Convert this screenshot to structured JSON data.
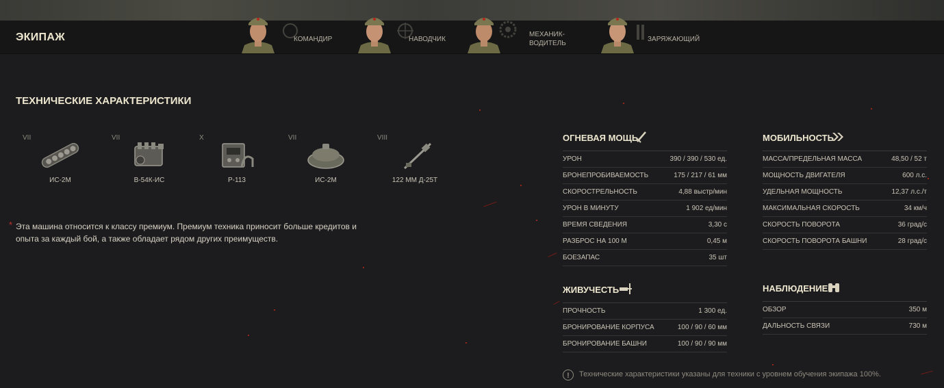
{
  "crew": {
    "title": "ЭКИПАЖ",
    "members": [
      {
        "role": "КОМАНДИР"
      },
      {
        "role": "НАВОДЧИК"
      },
      {
        "role_line1": "МЕХАНИК-",
        "role_line2": "ВОДИТЕЛЬ"
      },
      {
        "role": "ЗАРЯЖАЮЩИЙ"
      }
    ]
  },
  "specs": {
    "title": "ТЕХНИЧЕСКИЕ ХАРАКТЕРИСТИКИ",
    "modules": [
      {
        "tier": "VII",
        "name": "ИС-2М",
        "icon": "tracks-icon"
      },
      {
        "tier": "VII",
        "name": "В-54К-ИС",
        "icon": "engine-icon"
      },
      {
        "tier": "X",
        "name": "Р-113",
        "icon": "radio-icon"
      },
      {
        "tier": "VII",
        "name": "ИС-2М",
        "icon": "turret-icon"
      },
      {
        "tier": "VIII",
        "name": "122 ММ Д-25Т",
        "icon": "gun-icon"
      }
    ]
  },
  "premium_note": "Эта машина относится к классу премиум. Премиум техника приносит больше кредитов и опыта за каждый бой, а также обладает рядом других преимуществ.",
  "firepower": {
    "title": "ОГНЕВАЯ МОЩЬ",
    "rows": [
      {
        "label": "УРОН",
        "value": "390 / 390 / 530 ед."
      },
      {
        "label": "БРОНЕПРОБИВАЕМОСТЬ",
        "value": "175 / 217 / 61 мм"
      },
      {
        "label": "СКОРОСТРЕЛЬНОСТЬ",
        "value": "4,88 выстр/мин"
      },
      {
        "label": "УРОН В МИНУТУ",
        "value": "1 902 ед/мин"
      },
      {
        "label": "ВРЕМЯ СВЕДЕНИЯ",
        "value": "3,30 с"
      },
      {
        "label": "РАЗБРОС НА 100 М",
        "value": "0,45 м"
      },
      {
        "label": "БОЕЗАПАС",
        "value": "35 шт"
      }
    ]
  },
  "survivability": {
    "title": "ЖИВУЧЕСТЬ",
    "rows": [
      {
        "label": "ПРОЧНОСТЬ",
        "value": "1 300 ед."
      },
      {
        "label": "БРОНИРОВАНИЕ КОРПУСА",
        "value": "100 / 90 / 60 мм"
      },
      {
        "label": "БРОНИРОВАНИЕ БАШНИ",
        "value": "100 / 90 / 90 мм"
      }
    ]
  },
  "mobility": {
    "title": "МОБИЛЬНОСТЬ",
    "rows": [
      {
        "label": "МАССА/ПРЕДЕЛЬНАЯ МАССА",
        "value": "48,50 / 52 т"
      },
      {
        "label": "МОЩНОСТЬ ДВИГАТЕЛЯ",
        "value": "600 л.с."
      },
      {
        "label": "УДЕЛЬНАЯ МОЩНОСТЬ",
        "value": "12,37 л.с./т"
      },
      {
        "label": "МАКСИМАЛЬНАЯ СКОРОСТЬ",
        "value": "34 км/ч"
      },
      {
        "label": "СКОРОСТЬ ПОВОРОТА",
        "value": "36 град/с"
      },
      {
        "label": "СКОРОСТЬ ПОВОРОТА БАШНИ",
        "value": "28 град/с"
      }
    ]
  },
  "spotting": {
    "title": "НАБЛЮДЕНИЕ",
    "rows": [
      {
        "label": "ОБЗОР",
        "value": "350 м"
      },
      {
        "label": "ДАЛЬНОСТЬ СВЯЗИ",
        "value": "730 м"
      }
    ]
  },
  "footer_note": "Технические характеристики указаны для техники с уровнем обучения экипажа 100%.",
  "colors": {
    "accent_red": "#c2281f",
    "title": "#ede6cf",
    "bg": "#1c1c1e"
  }
}
